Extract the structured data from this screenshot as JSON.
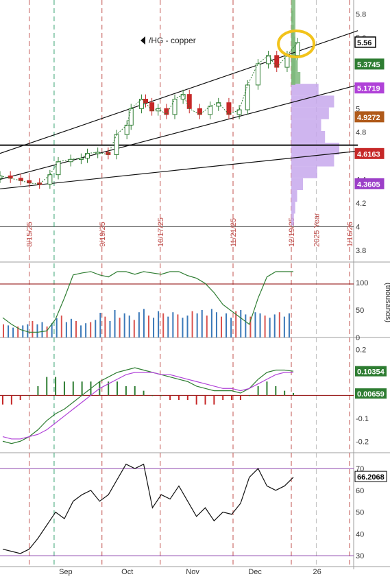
{
  "chart_data": [
    {
      "type": "candlestick",
      "title": "/HG - copper",
      "y_ticks": [
        "5.8",
        "5.6",
        "5.4",
        "5.2",
        "5",
        "4.8",
        "4.6",
        "4.4",
        "4.2",
        "4",
        "3.8"
      ],
      "ylim": [
        3.7,
        5.92
      ],
      "vertical_markers": [
        {
          "label": "8/15/25",
          "x": "2025-08-15"
        },
        {
          "label": "9/19/25",
          "x": "2025-09-19"
        },
        {
          "label": "10/17/25",
          "x": "2025-10-17"
        },
        {
          "label": "11/21/25",
          "x": "2025-11-21"
        },
        {
          "label": "12/19/25",
          "x": "2025-12-19"
        },
        {
          "label": "2025 Year",
          "x": "2025-12-31"
        },
        {
          "label": "1/16/26",
          "x": "2026-01-16"
        }
      ],
      "price_tags": [
        {
          "value": "5.56",
          "color": "#2e7d32",
          "border": "#000000"
        },
        {
          "value": "5.3745",
          "color": "#2e7d32",
          "border": "#2e7d32"
        },
        {
          "value": "5.1719",
          "color": "#b042d8",
          "border": "#b042d8"
        },
        {
          "value": "4.9272",
          "color": "#b05a1a",
          "border": "#b05a1a"
        },
        {
          "value": "4.6163",
          "color": "#c62828",
          "border": "#c62828"
        },
        {
          "value": "4.3605",
          "color": "#9c3fc8",
          "border": "#9c3fc8"
        }
      ],
      "trendlines": [
        {
          "name": "upper channel",
          "from": [
            "2025-08-01",
            4.62
          ],
          "to": [
            "2026-01-20",
            5.66
          ]
        },
        {
          "name": "lower channel",
          "from": [
            "2025-08-01",
            4.4
          ],
          "to": [
            "2026-01-20",
            5.2
          ]
        },
        {
          "name": "support line",
          "from": [
            "2025-08-01",
            4.32
          ],
          "to": [
            "2026-01-20",
            4.64
          ]
        },
        {
          "name": "horizontal level",
          "from": [
            "2025-08-01",
            4.69
          ],
          "to": [
            "2026-01-20",
            4.69
          ]
        }
      ],
      "closes": [
        {
          "x": "2025-08-01",
          "y": 4.43
        },
        {
          "x": "2025-08-06",
          "y": 4.41
        },
        {
          "x": "2025-08-11",
          "y": 4.39
        },
        {
          "x": "2025-08-15",
          "y": 4.37
        },
        {
          "x": "2025-08-20",
          "y": 4.36
        },
        {
          "x": "2025-08-25",
          "y": 4.44
        },
        {
          "x": "2025-08-29",
          "y": 4.55
        },
        {
          "x": "2025-09-04",
          "y": 4.57
        },
        {
          "x": "2025-09-09",
          "y": 4.58
        },
        {
          "x": "2025-09-12",
          "y": 4.62
        },
        {
          "x": "2025-09-17",
          "y": 4.63
        },
        {
          "x": "2025-09-22",
          "y": 4.61
        },
        {
          "x": "2025-09-26",
          "y": 4.78
        },
        {
          "x": "2025-10-01",
          "y": 4.86
        },
        {
          "x": "2025-10-03",
          "y": 5.0
        },
        {
          "x": "2025-10-08",
          "y": 5.08
        },
        {
          "x": "2025-10-10",
          "y": 5.05
        },
        {
          "x": "2025-10-13",
          "y": 4.98
        },
        {
          "x": "2025-10-16",
          "y": 5.0
        },
        {
          "x": "2025-10-20",
          "y": 4.95
        },
        {
          "x": "2025-10-24",
          "y": 5.08
        },
        {
          "x": "2025-10-28",
          "y": 5.12
        },
        {
          "x": "2025-10-31",
          "y": 5.0
        },
        {
          "x": "2025-11-05",
          "y": 4.95
        },
        {
          "x": "2025-11-10",
          "y": 5.02
        },
        {
          "x": "2025-11-14",
          "y": 5.05
        },
        {
          "x": "2025-11-19",
          "y": 4.95
        },
        {
          "x": "2025-11-24",
          "y": 4.99
        },
        {
          "x": "2025-11-28",
          "y": 5.2
        },
        {
          "x": "2025-12-03",
          "y": 5.38
        },
        {
          "x": "2025-12-08",
          "y": 5.45
        },
        {
          "x": "2025-12-12",
          "y": 5.35
        },
        {
          "x": "2025-12-17",
          "y": 5.45
        },
        {
          "x": "2025-12-22",
          "y": 5.56
        }
      ],
      "volume_profile": [
        {
          "price": 5.78,
          "volume": 3
        },
        {
          "price": 5.66,
          "volume": 4
        },
        {
          "price": 5.56,
          "volume": 6
        },
        {
          "price": 5.46,
          "volume": 8
        },
        {
          "price": 5.36,
          "volume": 10
        },
        {
          "price": 5.26,
          "volume": 14
        },
        {
          "price": 5.16,
          "volume": 42
        },
        {
          "price": 5.06,
          "volume": 66
        },
        {
          "price": 4.96,
          "volume": 58
        },
        {
          "price": 4.86,
          "volume": 46
        },
        {
          "price": 4.76,
          "volume": 52
        },
        {
          "price": 4.66,
          "volume": 74
        },
        {
          "price": 4.56,
          "volume": 66
        },
        {
          "price": 4.46,
          "volume": 40
        },
        {
          "price": 4.36,
          "volume": 18
        },
        {
          "price": 4.26,
          "volume": 9
        },
        {
          "price": 4.16,
          "volume": 6
        },
        {
          "price": 4.06,
          "volume": 4
        }
      ]
    },
    {
      "type": "bar",
      "name": "volume",
      "y_ticks": [
        "100",
        "50",
        "0"
      ],
      "axis_label": "(thousands)",
      "ylim": [
        0,
        130
      ],
      "volume_values": [
        24,
        22,
        18,
        20,
        22,
        24,
        30,
        24,
        28,
        20,
        26,
        35,
        40,
        28,
        34,
        30,
        22,
        26,
        28,
        32,
        45,
        38,
        30,
        50,
        36,
        44,
        40,
        32,
        46,
        52,
        40,
        36,
        48,
        44,
        38,
        46,
        42,
        36,
        40,
        48,
        44,
        50,
        40,
        52,
        46,
        38,
        44,
        36,
        48,
        50,
        42,
        38,
        46,
        44,
        40,
        36,
        42,
        46,
        38,
        44
      ],
      "stochastic": [
        30,
        20,
        12,
        8,
        8,
        10,
        28,
        60,
        95,
        98,
        100,
        95,
        92,
        100,
        100,
        96,
        100,
        98,
        96,
        100,
        100,
        94,
        90,
        82,
        68,
        50,
        40,
        30,
        20,
        60,
        92,
        100,
        100,
        100
      ]
    },
    {
      "type": "line",
      "name": "MACD",
      "y_ticks": [
        "0.2",
        "0.1",
        "0",
        "-0.1",
        "-0.2"
      ],
      "ylim": [
        -0.25,
        0.24
      ],
      "tags": [
        {
          "value": "0.10354",
          "color": "#2e7d32"
        },
        {
          "value": "0.00659",
          "color": "#2e7d32"
        }
      ],
      "macd": [
        -0.2,
        -0.21,
        -0.2,
        -0.18,
        -0.15,
        -0.11,
        -0.08,
        -0.06,
        -0.03,
        0.0,
        0.03,
        0.06,
        0.08,
        0.1,
        0.11,
        0.12,
        0.11,
        0.1,
        0.09,
        0.08,
        0.07,
        0.06,
        0.04,
        0.03,
        0.02,
        0.02,
        0.02,
        0.01,
        0.03,
        0.07,
        0.1,
        0.11,
        0.11,
        0.105
      ],
      "signal": [
        -0.18,
        -0.19,
        -0.19,
        -0.18,
        -0.17,
        -0.15,
        -0.12,
        -0.09,
        -0.06,
        -0.03,
        0.0,
        0.03,
        0.05,
        0.07,
        0.09,
        0.1,
        0.1,
        0.1,
        0.09,
        0.09,
        0.08,
        0.07,
        0.06,
        0.05,
        0.04,
        0.03,
        0.03,
        0.02,
        0.03,
        0.05,
        0.07,
        0.09,
        0.1,
        0.1
      ]
    },
    {
      "type": "line",
      "name": "RSI",
      "y_ticks": [
        "70",
        "60",
        "50",
        "40",
        "30"
      ],
      "ylim": [
        25,
        76
      ],
      "levels": [
        70,
        30
      ],
      "tag": {
        "value": "66.2068",
        "color": "#000000"
      },
      "rsi": [
        33,
        32,
        31,
        33,
        38,
        44,
        50,
        47,
        55,
        58,
        60,
        55,
        58,
        65,
        72,
        70,
        72,
        52,
        58,
        56,
        62,
        55,
        48,
        52,
        46,
        50,
        49,
        54,
        66,
        70,
        62,
        60,
        62,
        66
      ],
      "x_labels": [
        "Sep",
        "Oct",
        "Nov",
        "Dec",
        "26"
      ]
    }
  ]
}
